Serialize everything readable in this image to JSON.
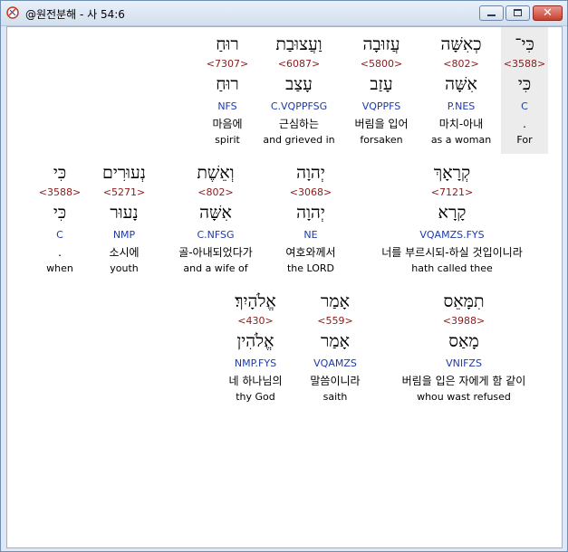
{
  "window": {
    "title": "@원전분해 - 사 54:6",
    "buttons": {
      "minimize": "",
      "maximize": "",
      "close": "✕"
    }
  },
  "verse": {
    "rows": [
      [
        {
          "heb": "רוּחַ",
          "strong": "<7307>",
          "lemma": "רוּחַ",
          "morph": "NFS",
          "kor": "마음에",
          "eng": "spirit"
        },
        {
          "heb": "וַעֲצוּבַת",
          "strong": "<6087>",
          "lemma": "עָצַב",
          "morph": "C.VQPPFSG",
          "kor": "근심하는",
          "eng": "and grieved in"
        },
        {
          "heb": "עֲזוּבָה",
          "strong": "<5800>",
          "lemma": "עָזַב",
          "morph": "VQPPFS",
          "kor": "버림을 입어",
          "eng": "forsaken"
        },
        {
          "heb": "כְאִשָּׁה",
          "strong": "<802>",
          "lemma": "אִשָּׁה",
          "morph": "P.NES",
          "kor": "마치-아내",
          "eng": "as a woman"
        },
        {
          "heb": "כִּי־",
          "strong": "<3588>",
          "lemma": "כִּי",
          "morph": "C",
          "kor": ".",
          "eng": "For"
        }
      ],
      [
        {
          "heb": "כִּי",
          "strong": "<3588>",
          "lemma": "כִּי",
          "morph": "C",
          "kor": ".",
          "eng": "when"
        },
        {
          "heb": "נְעוּרִים",
          "strong": "<5271>",
          "lemma": "נָעוּר",
          "morph": "NMP",
          "kor": "소시에",
          "eng": "youth"
        },
        {
          "heb": "וְאֵשֶׁת",
          "strong": "<802>",
          "lemma": "אִשָּׁה",
          "morph": "C.NFSG",
          "kor": "골-아내되었다가",
          "eng": "and a wife of"
        },
        {
          "heb": "יְהוָה",
          "strong": "<3068>",
          "lemma": "יְהוָה",
          "morph": "NE",
          "kor": "여호와께서",
          "eng": "the LORD"
        },
        {
          "heb": "קְרָאָךְ",
          "strong": "<7121>",
          "lemma": "קָרָא",
          "morph": "VQAMZS.FYS",
          "kor": "너를 부르시되-하실 것입이니라",
          "eng": "hath called thee"
        }
      ],
      [
        {
          "heb": "אֱלֹהָיִךְ׃",
          "strong": "<430>",
          "lemma": "אֱלֹהִין",
          "morph": "NMP.FYS",
          "kor": "네 하나님의",
          "eng": "thy God"
        },
        {
          "heb": "אָמַר",
          "strong": "<559>",
          "lemma": "אָמַר",
          "morph": "VQAMZS",
          "kor": "말씀이니라",
          "eng": "saith"
        },
        {
          "heb": "תִמָּאֵס",
          "strong": "<3988>",
          "lemma": "מָאַס",
          "morph": "VNIFZS",
          "kor": "버림을 입은 자에게 함 같이",
          "eng": "whou wast refused"
        }
      ]
    ]
  }
}
